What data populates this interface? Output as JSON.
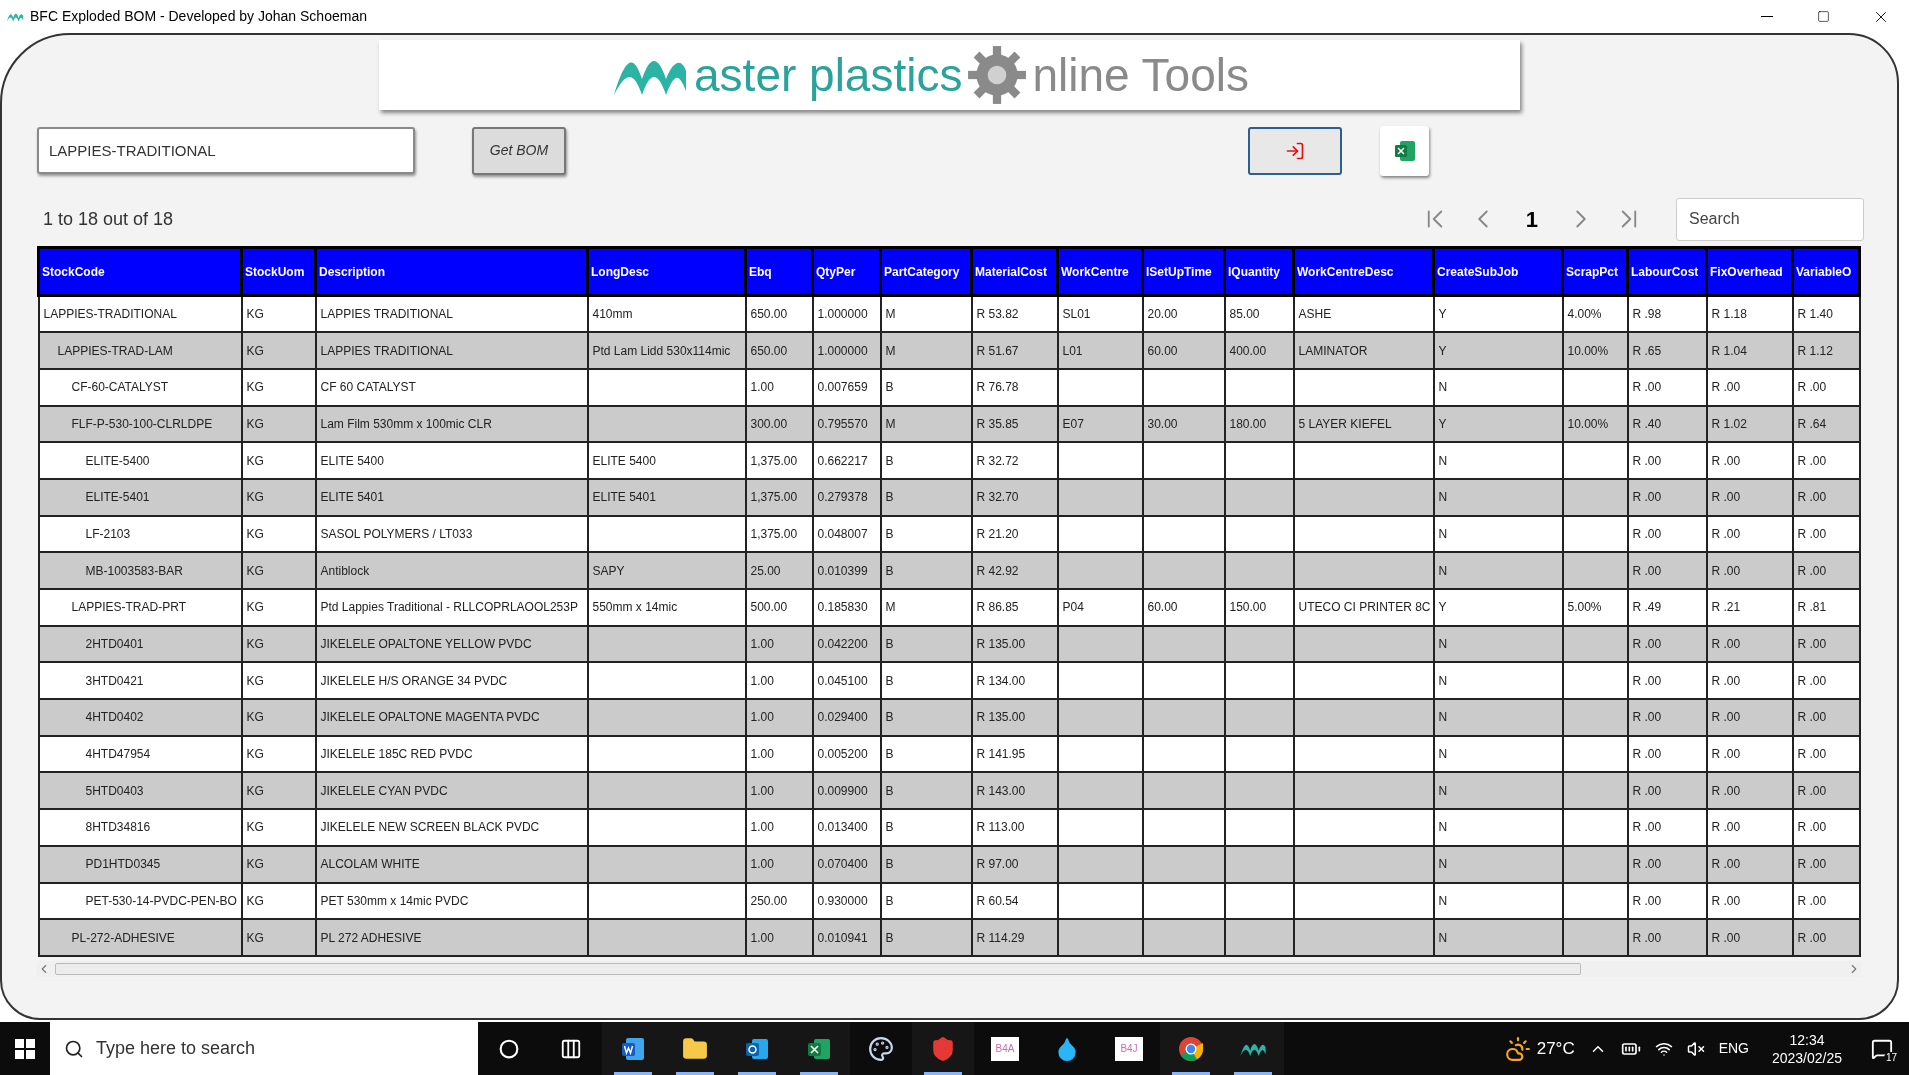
{
  "window": {
    "title": "BFC Exploded BOM - Developed by Johan Schoeman"
  },
  "logo": {
    "first_word": "aster plastics",
    "second_word": "nline Tools"
  },
  "stock_field": {
    "value": "LAPPIES-TRADITIONAL"
  },
  "get_bom_button": {
    "label": "Get BOM"
  },
  "record_count": "1 to 18 out of 18",
  "pager": {
    "page": "1"
  },
  "search": {
    "placeholder": "Search"
  },
  "table": {
    "columns": [
      "StockCode",
      "StockUom",
      "Description",
      "LongDesc",
      "Ebq",
      "QtyPer",
      "PartCategory",
      "MaterialCost",
      "WorkCentre",
      "ISetUpTime",
      "IQuantity",
      "WorkCentreDesc",
      "CreateSubJob",
      "ScrapPct",
      "LabourCost",
      "FixOverhead",
      "VariableO"
    ],
    "rows": [
      {
        "cells": [
          "LAPPIES-TRADITIONAL",
          "KG",
          "LAPPIES TRADITIONAL",
          "410mm",
          "650.00",
          "1.000000",
          "M",
          "R 53.82",
          "SL01",
          "20.00",
          "85.00",
          "ASHE",
          "Y",
          "4.00%",
          "R .98",
          "R 1.18",
          "R 1.40"
        ],
        "children": [
          {
            "cells": [
              "LAPPIES-TRAD-LAM",
              "KG",
              "LAPPIES TRADITIONAL",
              "Ptd Lam Lidd 530x114mic",
              "650.00",
              "1.000000",
              "M",
              "R 51.67",
              "L01",
              "60.00",
              "400.00",
              "LAMINATOR",
              "Y",
              "10.00%",
              "R .65",
              "R 1.04",
              "R 1.12"
            ],
            "children": [
              {
                "cells": [
                  "CF-60-CATALYST",
                  "KG",
                  "CF 60 CATALYST",
                  null,
                  "1.00",
                  "0.007659",
                  "B",
                  "R 76.78",
                  null,
                  null,
                  null,
                  null,
                  "N",
                  null,
                  "R .00",
                  "R .00",
                  "R .00"
                ]
              },
              {
                "cells": [
                  "FLF-P-530-100-CLRLDPE",
                  "KG",
                  "Lam Film 530mm x 100mic CLR",
                  null,
                  "300.00",
                  "0.795570",
                  "M",
                  "R 35.85",
                  "E07",
                  "30.00",
                  "180.00",
                  "5 LAYER KIEFEL",
                  "Y",
                  "10.00%",
                  "R .40",
                  "R 1.02",
                  "R .64"
                ],
                "children": [
                  {
                    "cells": [
                      "ELITE-5400",
                      "KG",
                      "ELITE 5400",
                      "ELITE 5400",
                      "1,375.00",
                      "0.662217",
                      "B",
                      "R 32.72",
                      null,
                      null,
                      null,
                      null,
                      "N",
                      null,
                      "R .00",
                      "R .00",
                      "R .00"
                    ]
                  },
                  {
                    "cells": [
                      "ELITE-5401",
                      "KG",
                      "ELITE 5401",
                      "ELITE 5401",
                      "1,375.00",
                      "0.279378",
                      "B",
                      "R 32.70",
                      null,
                      null,
                      null,
                      null,
                      "N",
                      null,
                      "R .00",
                      "R .00",
                      "R .00"
                    ]
                  },
                  {
                    "cells": [
                      "LF-2103",
                      "KG",
                      "SASOL POLYMERS / LT033",
                      null,
                      "1,375.00",
                      "0.048007",
                      "B",
                      "R 21.20",
                      null,
                      null,
                      null,
                      null,
                      "N",
                      null,
                      "R .00",
                      "R .00",
                      "R .00"
                    ]
                  },
                  {
                    "cells": [
                      "MB-1003583-BAR",
                      "KG",
                      "Antiblock",
                      "SAPY",
                      "25.00",
                      "0.010399",
                      "B",
                      "R 42.92",
                      null,
                      null,
                      null,
                      null,
                      "N",
                      null,
                      "R .00",
                      "R .00",
                      "R .00"
                    ]
                  }
                ]
              },
              {
                "cells": [
                  "LAPPIES-TRAD-PRT",
                  "KG",
                  "Ptd Lappies Traditional - RLLCOPRLAOOL253P",
                  "550mm x 14mic",
                  "500.00",
                  "0.185830",
                  "M",
                  "R 86.85",
                  "P04",
                  "60.00",
                  "150.00",
                  "UTECO CI PRINTER 8C",
                  "Y",
                  "5.00%",
                  "R .49",
                  "R .21",
                  "R .81"
                ],
                "children": [
                  {
                    "cells": [
                      "2HTD0401",
                      "KG",
                      "JIKELELE OPALTONE YELLOW PVDC",
                      null,
                      "1.00",
                      "0.042200",
                      "B",
                      "R 135.00",
                      null,
                      null,
                      null,
                      null,
                      "N",
                      null,
                      "R .00",
                      "R .00",
                      "R .00"
                    ]
                  },
                  {
                    "cells": [
                      "3HTD0421",
                      "KG",
                      "JIKELELE H/S ORANGE 34 PVDC",
                      null,
                      "1.00",
                      "0.045100",
                      "B",
                      "R 134.00",
                      null,
                      null,
                      null,
                      null,
                      "N",
                      null,
                      "R .00",
                      "R .00",
                      "R .00"
                    ]
                  },
                  {
                    "cells": [
                      "4HTD0402",
                      "KG",
                      "JIKELELE OPALTONE MAGENTA PVDC",
                      null,
                      "1.00",
                      "0.029400",
                      "B",
                      "R 135.00",
                      null,
                      null,
                      null,
                      null,
                      "N",
                      null,
                      "R .00",
                      "R .00",
                      "R .00"
                    ]
                  },
                  {
                    "cells": [
                      "4HTD47954",
                      "KG",
                      "JIKELELE 185C RED PVDC",
                      null,
                      "1.00",
                      "0.005200",
                      "B",
                      "R 141.95",
                      null,
                      null,
                      null,
                      null,
                      "N",
                      null,
                      "R .00",
                      "R .00",
                      "R .00"
                    ]
                  },
                  {
                    "cells": [
                      "5HTD0403",
                      "KG",
                      "JIKELELE CYAN PVDC",
                      null,
                      "1.00",
                      "0.009900",
                      "B",
                      "R 143.00",
                      null,
                      null,
                      null,
                      null,
                      "N",
                      null,
                      "R .00",
                      "R .00",
                      "R .00"
                    ]
                  },
                  {
                    "cells": [
                      "8HTD34816",
                      "KG",
                      "JIKELELE NEW SCREEN BLACK PVDC",
                      null,
                      "1.00",
                      "0.013400",
                      "B",
                      "R 113.00",
                      null,
                      null,
                      null,
                      null,
                      "N",
                      null,
                      "R .00",
                      "R .00",
                      "R .00"
                    ]
                  },
                  {
                    "cells": [
                      "PD1HTD0345",
                      "KG",
                      "ALCOLAM WHITE",
                      null,
                      "1.00",
                      "0.070400",
                      "B",
                      "R 97.00",
                      null,
                      null,
                      null,
                      null,
                      "N",
                      null,
                      "R .00",
                      "R .00",
                      "R .00"
                    ]
                  },
                  {
                    "cells": [
                      "PET-530-14-PVDC-PEN-BO",
                      "KG",
                      "PET 530mm x 14mic PVDC",
                      null,
                      "250.00",
                      "0.930000",
                      "B",
                      "R 60.54",
                      null,
                      null,
                      null,
                      null,
                      "N",
                      null,
                      "R .00",
                      "R .00",
                      "R .00"
                    ]
                  }
                ]
              },
              {
                "cells": [
                  "PL-272-ADHESIVE",
                  "KG",
                  "PL 272 ADHESIVE",
                  null,
                  "1.00",
                  "0.010941",
                  "B",
                  "R 114.29",
                  null,
                  null,
                  null,
                  null,
                  "N",
                  null,
                  "R .00",
                  "R .00",
                  "R .00"
                ]
              }
            ]
          }
        ]
      }
    ]
  },
  "taskbar": {
    "search_placeholder": "Type here to search",
    "apps": [
      {
        "kind": "cortana",
        "open": false
      },
      {
        "kind": "taskview",
        "open": false
      },
      {
        "kind": "word",
        "open": true
      },
      {
        "kind": "explorer",
        "open": true
      },
      {
        "kind": "outlook",
        "open": true
      },
      {
        "kind": "excel",
        "open": true
      },
      {
        "kind": "palette",
        "open": false
      },
      {
        "kind": "shield",
        "open": true
      },
      {
        "kind": "tile",
        "label": "B4A",
        "open": false
      },
      {
        "kind": "drop",
        "open": false
      },
      {
        "kind": "tile",
        "label": "B4J",
        "open": false
      },
      {
        "kind": "chrome",
        "open": true
      },
      {
        "kind": "swoosh",
        "open": true
      }
    ],
    "temperature": "27°C",
    "language": "ENG",
    "time": "12:34",
    "date": "2023/02/25",
    "notifications": "17"
  }
}
